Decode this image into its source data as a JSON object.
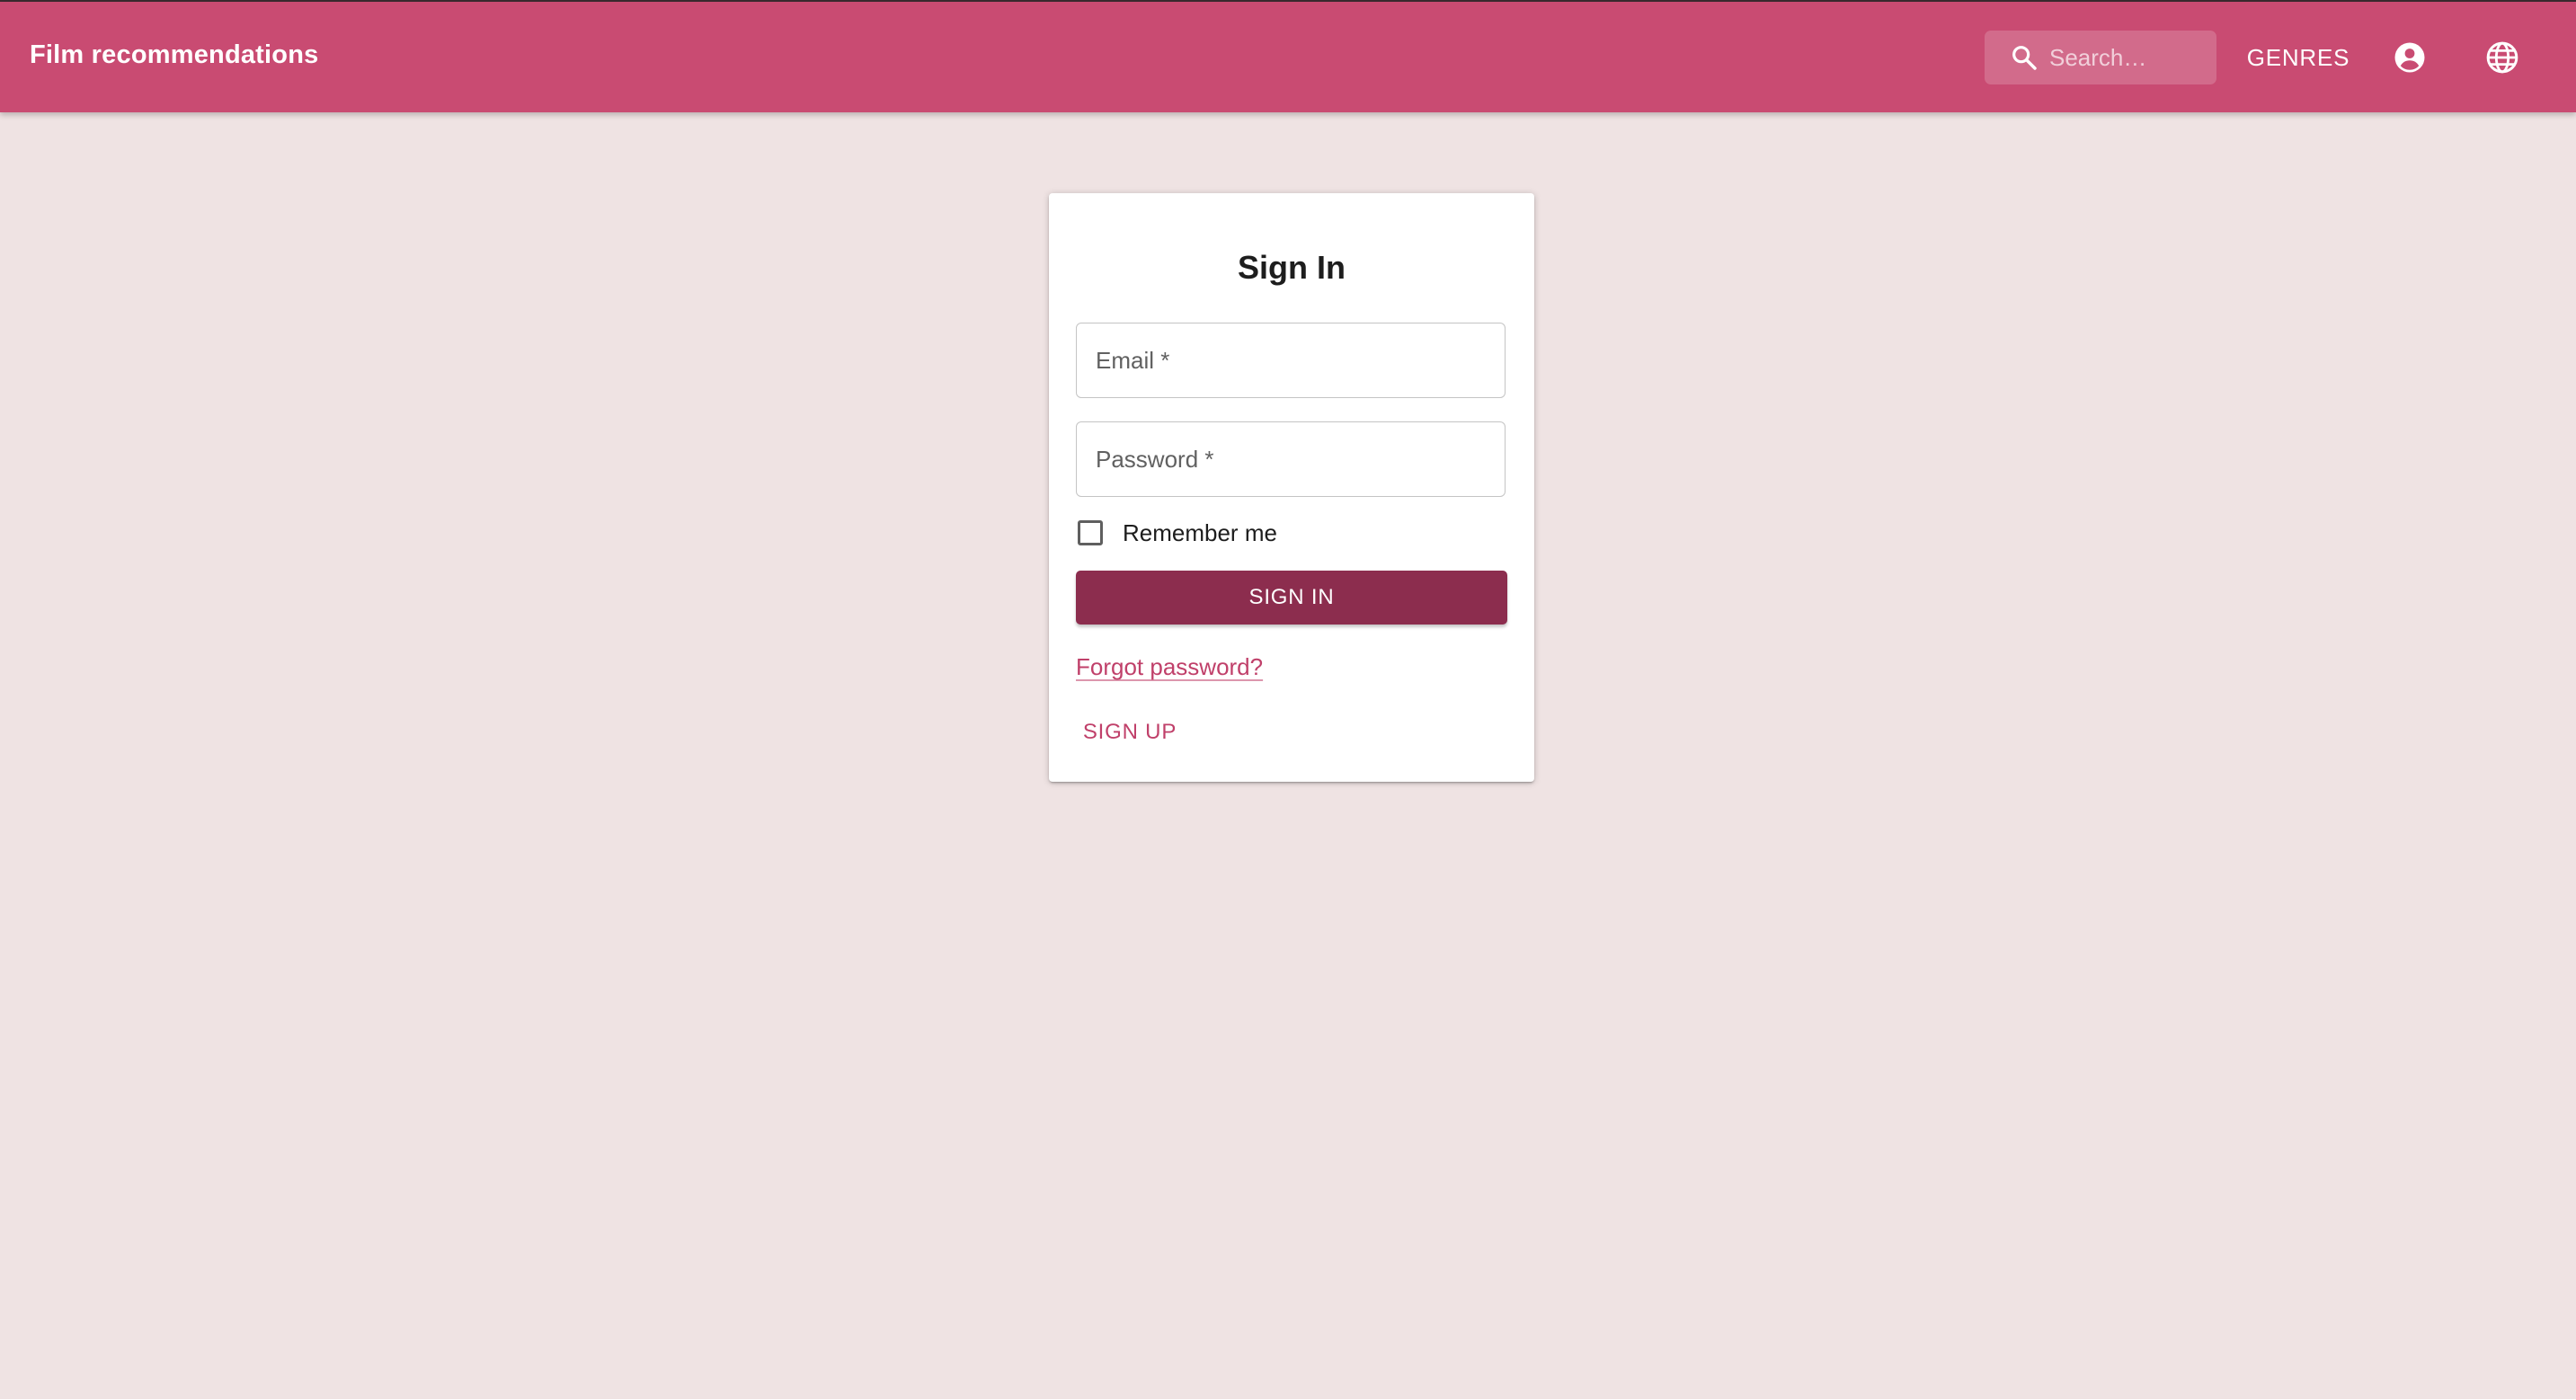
{
  "app": {
    "title": "Film recommendations"
  },
  "header": {
    "search": {
      "placeholder": "Search…",
      "value": ""
    },
    "genres_label": "GENRES",
    "account_icon": "account-circle-icon",
    "language_icon": "globe-icon"
  },
  "signin_form": {
    "title": "Sign In",
    "email_label": "Email *",
    "password_label": "Password *",
    "remember_label": "Remember me",
    "remember_checked": false,
    "submit_label": "SIGN IN",
    "forgot_label": "Forgot password?",
    "signup_label": "SIGN UP"
  },
  "colors": {
    "appbar": "#c94b72",
    "background": "#efe3e3",
    "primary_button": "#8c2d4e",
    "link": "#c0406a"
  }
}
